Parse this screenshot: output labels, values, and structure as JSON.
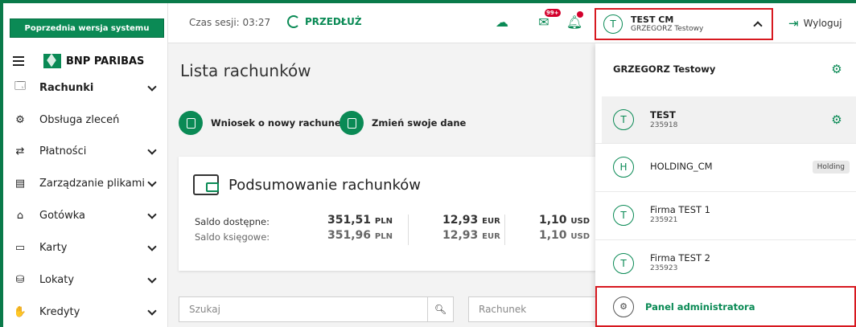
{
  "sidebar": {
    "previous_version_label": "Poprzednia wersja systemu",
    "logo_text": "BNP PARIBAS",
    "items": [
      {
        "label": "Rachunki",
        "icon": "account-icon",
        "glyph": "🗔",
        "has_chevron": true,
        "bold": true
      },
      {
        "label": "Obsługa zleceń",
        "icon": "orders-icon",
        "glyph": "⚙",
        "has_chevron": false,
        "bold": false
      },
      {
        "label": "Płatności",
        "icon": "payments-icon",
        "glyph": "⇄",
        "has_chevron": true,
        "bold": false
      },
      {
        "label": "Zarządzanie plikami",
        "icon": "files-icon",
        "glyph": "▤",
        "has_chevron": true,
        "bold": false
      },
      {
        "label": "Gotówka",
        "icon": "cash-icon",
        "glyph": "⌂",
        "has_chevron": true,
        "bold": false
      },
      {
        "label": "Karty",
        "icon": "card-icon",
        "glyph": "▭",
        "has_chevron": true,
        "bold": false
      },
      {
        "label": "Lokaty",
        "icon": "deposit-icon",
        "glyph": "⛁",
        "has_chevron": true,
        "bold": false
      },
      {
        "label": "Kredyty",
        "icon": "loan-icon",
        "glyph": "✋",
        "has_chevron": true,
        "bold": false
      }
    ]
  },
  "topbar": {
    "session_text": "Czas sesji: 03:27",
    "extend_label": "PRZEDŁUŻ",
    "messages_badge": "99+",
    "user_name": "TEST CM",
    "user_sub": "GRZEGORZ Testowy",
    "logout_label": "Wyloguj"
  },
  "main": {
    "title": "Lista rachunków",
    "actions": [
      "Wniosek o nowy rachunek",
      "Zmień swoje dane"
    ],
    "summary": {
      "title": "Podsumowanie rachunków",
      "rows": [
        {
          "label": "Saldo dostępne:",
          "amounts": [
            {
              "value": "351,51",
              "currency": "PLN"
            },
            {
              "value": "12,93",
              "currency": "EUR"
            },
            {
              "value": "1,10",
              "currency": "USD"
            }
          ]
        },
        {
          "label": "Saldo księgowe:",
          "amounts": [
            {
              "value": "351,96",
              "currency": "PLN"
            },
            {
              "value": "12,93",
              "currency": "EUR"
            },
            {
              "value": "1,10",
              "currency": "USD"
            }
          ]
        }
      ]
    },
    "search_placeholder": "Szukaj",
    "account_placeholder": "Rachunek"
  },
  "dropdown": {
    "header_name": "GRZEGORZ Testowy",
    "companies": [
      {
        "initial": "T",
        "name": "TEST",
        "id": "235918",
        "badge": "",
        "active": true
      },
      {
        "initial": "H",
        "name": "HOLDING_CM",
        "id": "",
        "badge": "Holding",
        "active": false
      },
      {
        "initial": "T",
        "name": "Firma TEST 1",
        "id": "235921",
        "badge": "",
        "active": false
      },
      {
        "initial": "T",
        "name": "Firma TEST 2",
        "id": "235923",
        "badge": "",
        "active": false
      }
    ],
    "admin_label": "Panel administratora"
  },
  "colors": {
    "brand_green": "#0a8a55",
    "highlight_red": "#d71920",
    "badge_red": "#d3002c"
  }
}
